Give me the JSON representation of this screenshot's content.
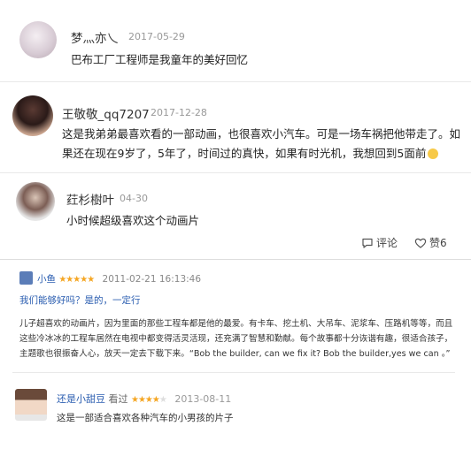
{
  "comments": [
    {
      "user": "梦灬亦乀",
      "date": "2017-05-29",
      "text": "巴布工厂工程师是我童年的美好回忆"
    },
    {
      "user": "王敬敬_qq7207",
      "date": "2017-12-28",
      "lines": [
        "这是我弟弟最喜欢看的一部动画，也很喜欢小汽车。可是一场车祸把他带走了。如",
        "果还在现在9岁了，5年了，时间过的真快，如果有时光机，我想回到5面前"
      ]
    },
    {
      "user": "荭杉樹叶",
      "date": "04-30",
      "text": "小时候超级喜欢这个动画片",
      "actions": {
        "comment": "评论",
        "like": "赞6"
      }
    }
  ],
  "review1": {
    "user": "小鱼",
    "stars": "★★★★★",
    "date": "2011-02-21 16:13:46",
    "helpful": "我们能够好吗？是的，一定行",
    "lines": [
      "儿子超喜欢的动画片，因为里面的那些工程车都是他的最爱。有卡车、挖土机、大吊车、泥浆车、压路机等等，而且",
      "这些冷冰冰的工程车居然在电视中都变得活灵活现，还充满了智慧和勤献。每个故事都十分诙谐有趣，很适合孩子，",
      "主题歌也很振奋人心，放天一定去下载下来。“Bob the builder, can we fix it? Bob the builder,yes we can 。”"
    ]
  },
  "review2": {
    "user": "还是小甜豆",
    "verb": "看过",
    "stars": "★★★★",
    "star_empty": "★",
    "date": "2013-08-11",
    "text": "这是一部适合喜欢各种汽车的小男孩的片子"
  }
}
